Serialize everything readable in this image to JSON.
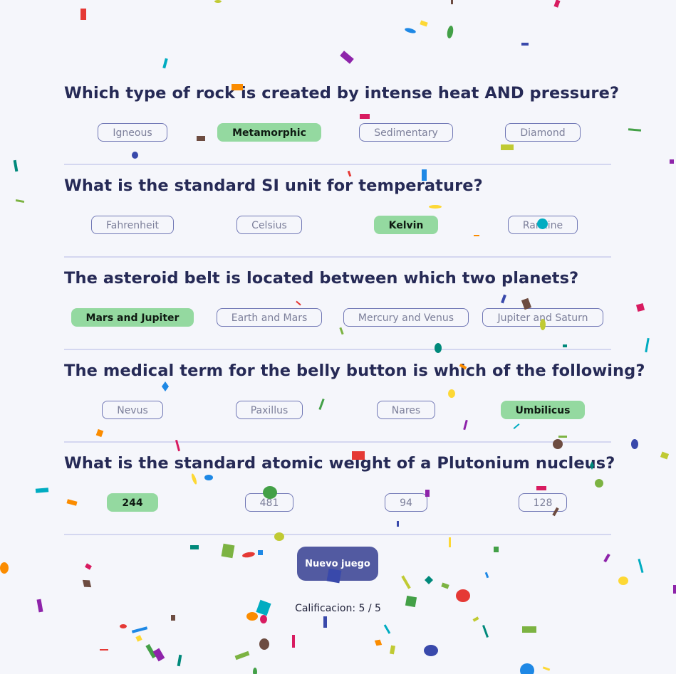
{
  "questions": [
    {
      "text": "Which type of rock is created by intense heat AND pressure?",
      "answers": [
        "Igneous",
        "Metamorphic",
        "Sedimentary",
        "Diamond"
      ],
      "correct_index": 1
    },
    {
      "text": "What is the standard SI unit for temperature?",
      "answers": [
        "Fahrenheit",
        "Celsius",
        "Kelvin",
        "Rankine"
      ],
      "correct_index": 2
    },
    {
      "text": "The asteroid belt is located between which two planets?",
      "answers": [
        "Mars and Jupiter",
        "Earth and Mars",
        "Mercury and Venus",
        "Jupiter and Saturn"
      ],
      "correct_index": 0
    },
    {
      "text": "The medical term for the belly button is which of the following?",
      "answers": [
        "Nevus",
        "Paxillus",
        "Nares",
        "Umbilicus"
      ],
      "correct_index": 3
    },
    {
      "text": "What is the standard atomic weight of a Plutonium nucleus?",
      "answers": [
        "244",
        "481",
        "94",
        "128"
      ],
      "correct_index": 0
    }
  ],
  "new_game_label": "Nuevo juego",
  "score_text": "Calificacion: 5 / 5",
  "colors": {
    "background": "#f5f6fb",
    "question_text": "#262a56",
    "answer_border": "#7077b5",
    "correct_answer_bg": "#94d9a0",
    "button_bg": "#525aa1",
    "divider": "#d4d7f0"
  },
  "confetti_colors": [
    "#e53935",
    "#1e88e5",
    "#fdd835",
    "#43a047",
    "#8e24aa",
    "#00acc1",
    "#fb8c00",
    "#d81b60",
    "#6d4c41",
    "#3949ab",
    "#c0ca33",
    "#00897b",
    "#7cb342"
  ]
}
